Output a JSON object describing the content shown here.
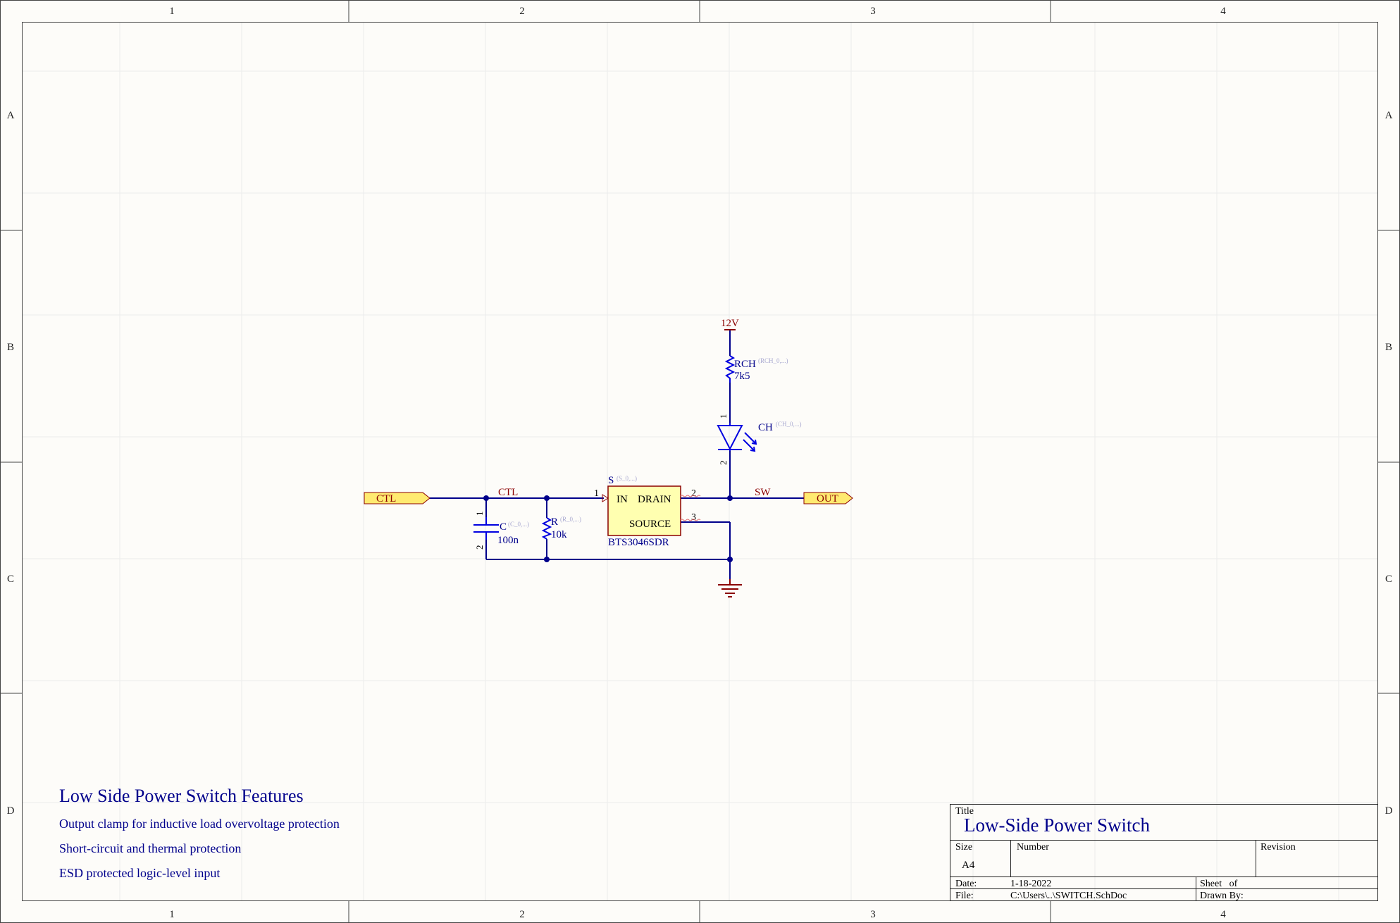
{
  "border": {
    "columns": [
      "1",
      "2",
      "3",
      "4"
    ],
    "rows": [
      "A",
      "B",
      "C",
      "D"
    ]
  },
  "nets": {
    "ctl": "CTL",
    "sw": "SW",
    "supply": "12V"
  },
  "ports": {
    "input": "CTL",
    "output": "OUT"
  },
  "components": {
    "switch": {
      "designator": "S",
      "param": "(S_0,...)",
      "part": "BTS3046SDR",
      "pin_in_label": "IN",
      "pin_drain_label": "DRAIN",
      "pin_source_label": "SOURCE",
      "pin_in_num": "1",
      "pin_drain_num": "2",
      "pin_source_num": "3"
    },
    "cap": {
      "designator": "C",
      "param": "(C_0,...)",
      "value": "100n",
      "pin1": "1",
      "pin2": "2"
    },
    "res": {
      "designator": "R",
      "param": "(R_0,...)",
      "value": "10k"
    },
    "rch": {
      "designator": "RCH",
      "param": "(RCH_0,...)",
      "value": "7k5"
    },
    "led": {
      "designator": "CH",
      "param": "(CH_0,...)",
      "pin1": "1",
      "pin2": "2"
    }
  },
  "notes": {
    "heading": "Low Side Power Switch Features",
    "items": [
      "Output clamp for inductive load overvoltage protection",
      "Short-circuit and thermal protection",
      "ESD protected logic-level input"
    ]
  },
  "title_block": {
    "title_label": "Title",
    "title": "Low-Side Power Switch",
    "size_label": "Size",
    "size": "A4",
    "number_label": "Number",
    "revision_label": "Revision",
    "date_label": "Date:",
    "date": "1-18-2022",
    "sheet_label": "Sheet   of",
    "file_label": "File:",
    "file": "C:\\Users\\..\\SWITCH.SchDoc",
    "drawn_by_label": "Drawn By:"
  },
  "colors": {
    "wire": "#00008b",
    "component": "#0000e0",
    "power": "#8b0000",
    "body_fill": "#ffffb0",
    "body_stroke": "#8b0000",
    "port_fill": "#ffea70",
    "text": "#00008b"
  }
}
